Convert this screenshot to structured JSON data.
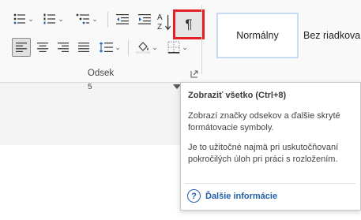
{
  "ribbon": {
    "group_label": "Odsek",
    "dropdown_glyph": "⌄",
    "show_all_glyph": "¶",
    "sort_glyph_az": "A Z",
    "styles": {
      "normal": "Normálny",
      "no_spacing": "Bez riadkova"
    }
  },
  "ruler": {
    "number": "5"
  },
  "tooltip": {
    "title": "Zobraziť všetko (Ctrl+8)",
    "description": "Zobrazí značky odsekov a ďalšie skryté formátovacie symboly.",
    "note": "Je to užitočné najmä pri uskutočňovaní pokročilých úloh pri práci s rozložením.",
    "help_glyph": "?",
    "link_label": "Ďalšie informácie"
  },
  "colors": {
    "highlight_border": "#e22026",
    "link": "#1f5ea8"
  }
}
